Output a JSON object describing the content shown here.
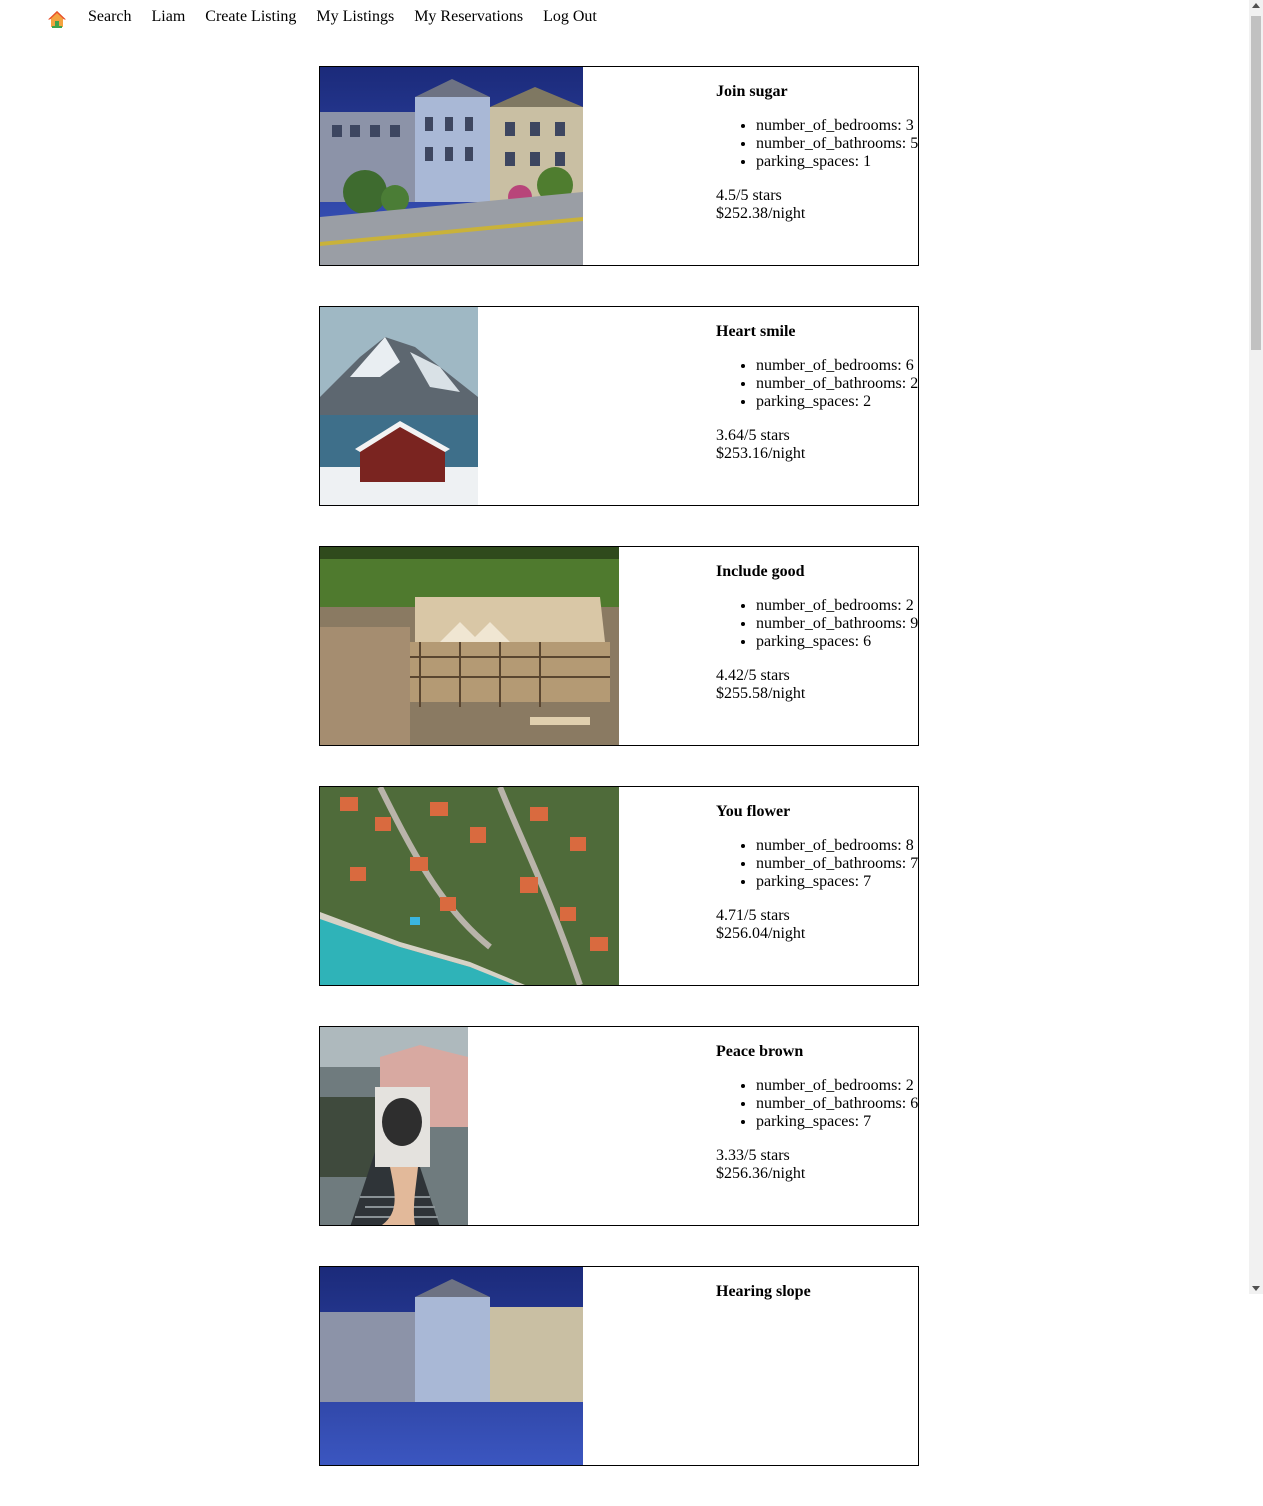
{
  "nav": {
    "home_icon": "house-icon",
    "links": [
      "Search",
      "Liam",
      "Create Listing",
      "My Listings",
      "My Reservations",
      "Log Out"
    ]
  },
  "listings": [
    {
      "title": "Join sugar",
      "features": [
        "number_of_bedrooms: 3",
        "number_of_bathrooms: 5",
        "parking_spaces: 1"
      ],
      "rating": "4.5/5 stars",
      "price": "$252.38/night",
      "image": "townhouses-photo"
    },
    {
      "title": "Heart smile",
      "features": [
        "number_of_bedrooms: 6",
        "number_of_bathrooms: 2",
        "parking_spaces: 2"
      ],
      "rating": "3.64/5 stars",
      "price": "$253.16/night",
      "image": "mountain-cabin-photo"
    },
    {
      "title": "Include good",
      "features": [
        "number_of_bedrooms: 2",
        "number_of_bathrooms: 9",
        "parking_spaces: 6"
      ],
      "rating": "4.42/5 stars",
      "price": "$255.58/night",
      "image": "construction-site-photo"
    },
    {
      "title": "You flower",
      "features": [
        "number_of_bedrooms: 8",
        "number_of_bathrooms: 7",
        "parking_spaces: 7"
      ],
      "rating": "4.71/5 stars",
      "price": "$256.04/night",
      "image": "aerial-village-photo"
    },
    {
      "title": "Peace brown",
      "features": [
        "number_of_bedrooms: 2",
        "number_of_bathrooms: 6",
        "parking_spaces: 7"
      ],
      "rating": "3.33/5 stars",
      "price": "$256.36/night",
      "image": "hand-held-photo"
    },
    {
      "title": "Hearing slope",
      "features": [],
      "rating": "",
      "price": "",
      "image": "townhouses-photo"
    }
  ]
}
